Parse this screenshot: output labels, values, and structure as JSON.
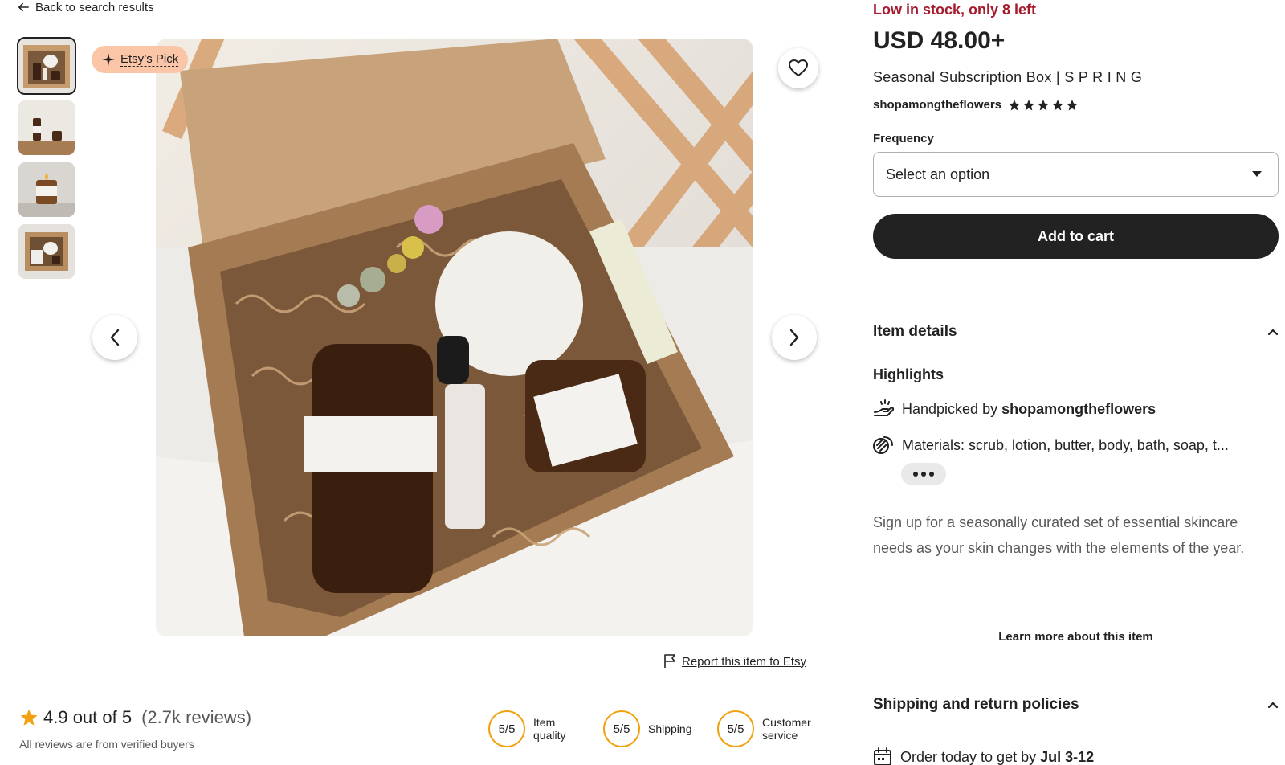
{
  "nav": {
    "back_label": "Back to search results"
  },
  "gallery": {
    "badge_label": "Etsy’s Pick",
    "thumbnail_count": 4,
    "active_thumbnail": 1
  },
  "report": {
    "label": "Report this item to Etsy"
  },
  "reviews": {
    "score_text": "4.9 out of 5",
    "count_text": "(2.7k reviews)",
    "verified_text": "All reviews are from verified buyers",
    "scores": [
      {
        "value": "5/5",
        "label_line1": "Item",
        "label_line2": "quality"
      },
      {
        "value": "5/5",
        "label_line1": "Shipping",
        "label_line2": ""
      },
      {
        "value": "5/5",
        "label_line1": "Customer",
        "label_line2": "service"
      }
    ]
  },
  "product": {
    "stock_text": "Low in stock, only 8 left",
    "price": "USD 48.00+",
    "title": "Seasonal Subscription Box | S P R I N G",
    "shop_name": "shopamongtheflowers",
    "shop_rating_stars": 5
  },
  "frequency": {
    "label": "Frequency",
    "selected": "Select an option"
  },
  "cart": {
    "label": "Add to cart"
  },
  "item_details": {
    "heading": "Item details",
    "highlights_heading": "Highlights",
    "handpicked_prefix": "Handpicked by ",
    "handpicked_shop": "shopamongtheflowers",
    "materials": "Materials: scrub, lotion, butter, body, bath, soap, t...",
    "description": "Sign up for a seasonally curated set of essential skincare needs as your skin changes with the elements of the year.",
    "learn_more": "Learn more about this item"
  },
  "shipping": {
    "heading": "Shipping and return policies",
    "order_prefix": "Order today to get by ",
    "order_date": "Jul 3-12"
  },
  "colors": {
    "stock_red": "#a61a2e",
    "badge_peach": "#fbc5a7",
    "ring_orange": "#f1a10d",
    "star_orange": "#f1a10d",
    "button_dark": "#222222"
  }
}
